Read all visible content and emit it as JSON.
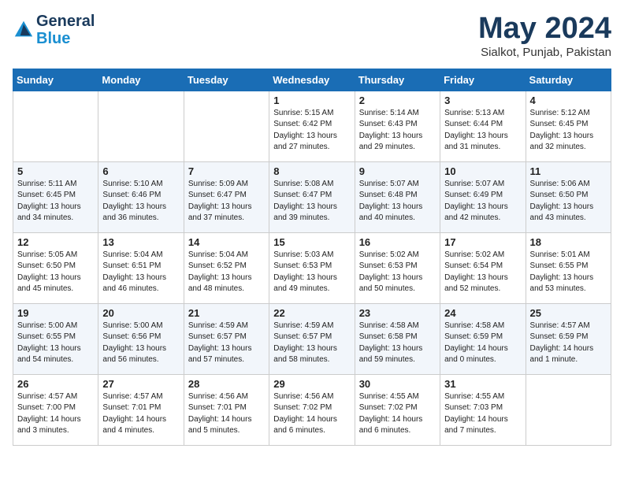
{
  "header": {
    "logo_line1": "General",
    "logo_line2": "Blue",
    "month": "May 2024",
    "location": "Sialkot, Punjab, Pakistan"
  },
  "days_of_week": [
    "Sunday",
    "Monday",
    "Tuesday",
    "Wednesday",
    "Thursday",
    "Friday",
    "Saturday"
  ],
  "weeks": [
    [
      {
        "day": "",
        "detail": ""
      },
      {
        "day": "",
        "detail": ""
      },
      {
        "day": "",
        "detail": ""
      },
      {
        "day": "1",
        "detail": "Sunrise: 5:15 AM\nSunset: 6:42 PM\nDaylight: 13 hours\nand 27 minutes."
      },
      {
        "day": "2",
        "detail": "Sunrise: 5:14 AM\nSunset: 6:43 PM\nDaylight: 13 hours\nand 29 minutes."
      },
      {
        "day": "3",
        "detail": "Sunrise: 5:13 AM\nSunset: 6:44 PM\nDaylight: 13 hours\nand 31 minutes."
      },
      {
        "day": "4",
        "detail": "Sunrise: 5:12 AM\nSunset: 6:45 PM\nDaylight: 13 hours\nand 32 minutes."
      }
    ],
    [
      {
        "day": "5",
        "detail": "Sunrise: 5:11 AM\nSunset: 6:45 PM\nDaylight: 13 hours\nand 34 minutes."
      },
      {
        "day": "6",
        "detail": "Sunrise: 5:10 AM\nSunset: 6:46 PM\nDaylight: 13 hours\nand 36 minutes."
      },
      {
        "day": "7",
        "detail": "Sunrise: 5:09 AM\nSunset: 6:47 PM\nDaylight: 13 hours\nand 37 minutes."
      },
      {
        "day": "8",
        "detail": "Sunrise: 5:08 AM\nSunset: 6:47 PM\nDaylight: 13 hours\nand 39 minutes."
      },
      {
        "day": "9",
        "detail": "Sunrise: 5:07 AM\nSunset: 6:48 PM\nDaylight: 13 hours\nand 40 minutes."
      },
      {
        "day": "10",
        "detail": "Sunrise: 5:07 AM\nSunset: 6:49 PM\nDaylight: 13 hours\nand 42 minutes."
      },
      {
        "day": "11",
        "detail": "Sunrise: 5:06 AM\nSunset: 6:50 PM\nDaylight: 13 hours\nand 43 minutes."
      }
    ],
    [
      {
        "day": "12",
        "detail": "Sunrise: 5:05 AM\nSunset: 6:50 PM\nDaylight: 13 hours\nand 45 minutes."
      },
      {
        "day": "13",
        "detail": "Sunrise: 5:04 AM\nSunset: 6:51 PM\nDaylight: 13 hours\nand 46 minutes."
      },
      {
        "day": "14",
        "detail": "Sunrise: 5:04 AM\nSunset: 6:52 PM\nDaylight: 13 hours\nand 48 minutes."
      },
      {
        "day": "15",
        "detail": "Sunrise: 5:03 AM\nSunset: 6:53 PM\nDaylight: 13 hours\nand 49 minutes."
      },
      {
        "day": "16",
        "detail": "Sunrise: 5:02 AM\nSunset: 6:53 PM\nDaylight: 13 hours\nand 50 minutes."
      },
      {
        "day": "17",
        "detail": "Sunrise: 5:02 AM\nSunset: 6:54 PM\nDaylight: 13 hours\nand 52 minutes."
      },
      {
        "day": "18",
        "detail": "Sunrise: 5:01 AM\nSunset: 6:55 PM\nDaylight: 13 hours\nand 53 minutes."
      }
    ],
    [
      {
        "day": "19",
        "detail": "Sunrise: 5:00 AM\nSunset: 6:55 PM\nDaylight: 13 hours\nand 54 minutes."
      },
      {
        "day": "20",
        "detail": "Sunrise: 5:00 AM\nSunset: 6:56 PM\nDaylight: 13 hours\nand 56 minutes."
      },
      {
        "day": "21",
        "detail": "Sunrise: 4:59 AM\nSunset: 6:57 PM\nDaylight: 13 hours\nand 57 minutes."
      },
      {
        "day": "22",
        "detail": "Sunrise: 4:59 AM\nSunset: 6:57 PM\nDaylight: 13 hours\nand 58 minutes."
      },
      {
        "day": "23",
        "detail": "Sunrise: 4:58 AM\nSunset: 6:58 PM\nDaylight: 13 hours\nand 59 minutes."
      },
      {
        "day": "24",
        "detail": "Sunrise: 4:58 AM\nSunset: 6:59 PM\nDaylight: 14 hours\nand 0 minutes."
      },
      {
        "day": "25",
        "detail": "Sunrise: 4:57 AM\nSunset: 6:59 PM\nDaylight: 14 hours\nand 1 minute."
      }
    ],
    [
      {
        "day": "26",
        "detail": "Sunrise: 4:57 AM\nSunset: 7:00 PM\nDaylight: 14 hours\nand 3 minutes."
      },
      {
        "day": "27",
        "detail": "Sunrise: 4:57 AM\nSunset: 7:01 PM\nDaylight: 14 hours\nand 4 minutes."
      },
      {
        "day": "28",
        "detail": "Sunrise: 4:56 AM\nSunset: 7:01 PM\nDaylight: 14 hours\nand 5 minutes."
      },
      {
        "day": "29",
        "detail": "Sunrise: 4:56 AM\nSunset: 7:02 PM\nDaylight: 14 hours\nand 6 minutes."
      },
      {
        "day": "30",
        "detail": "Sunrise: 4:55 AM\nSunset: 7:02 PM\nDaylight: 14 hours\nand 6 minutes."
      },
      {
        "day": "31",
        "detail": "Sunrise: 4:55 AM\nSunset: 7:03 PM\nDaylight: 14 hours\nand 7 minutes."
      },
      {
        "day": "",
        "detail": ""
      }
    ]
  ]
}
